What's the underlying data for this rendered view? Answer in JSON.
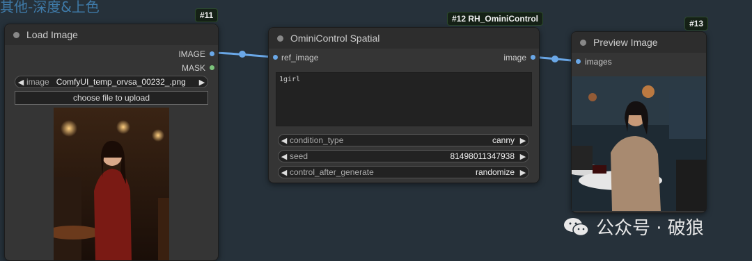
{
  "group": {
    "title": "其他-深度&上色"
  },
  "colors": {
    "link": "#6aa8e8",
    "mask": "#7cc47c",
    "badge_bg": "#152116"
  },
  "nodes": {
    "load_image": {
      "badge": "#11",
      "title": "Load Image",
      "outputs": [
        "IMAGE",
        "MASK"
      ],
      "image_widget": {
        "label": "image",
        "value": "ComfyUI_temp_orvsa_00232_.png"
      },
      "upload_button": "choose file to upload"
    },
    "ominicontrol": {
      "badge": "#12 RH_OminiControl",
      "title": "OminiControl Spatial",
      "input": "ref_image",
      "output": "image",
      "prompt": "1girl",
      "widgets": [
        {
          "label": "condition_type",
          "value": "canny"
        },
        {
          "label": "seed",
          "value": "81498011347938"
        },
        {
          "label": "control_after_generate",
          "value": "randomize"
        }
      ]
    },
    "preview_image": {
      "badge": "#13",
      "title": "Preview Image",
      "input": "images"
    }
  },
  "watermark": {
    "text": "公众号 · 破狼",
    "icon": "wechat-icon"
  }
}
